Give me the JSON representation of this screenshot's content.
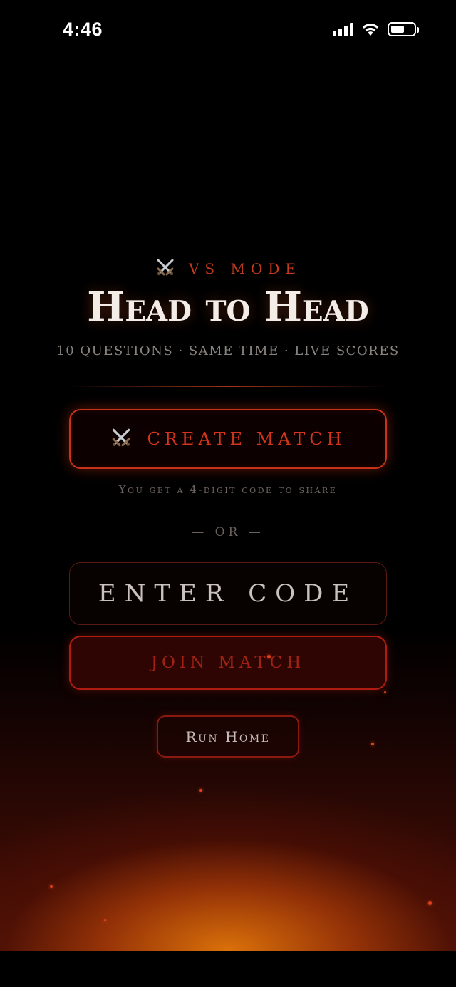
{
  "status_bar": {
    "time": "4:46",
    "signal_icon": "cellular-signal-icon",
    "wifi_icon": "wifi-icon",
    "battery_icon": "battery-icon",
    "battery_level": 0.6
  },
  "header": {
    "kicker_icon": "crossed-swords-icon",
    "kicker": "VS MODE",
    "title": "Head to Head",
    "subtitle": "10 QUESTIONS · SAME TIME · LIVE SCORES"
  },
  "actions": {
    "create_icon": "crossed-swords-icon",
    "create_label": "CREATE MATCH",
    "create_hint": "You get a 4-digit code to share",
    "or_label": "— OR —",
    "code_placeholder": "ENTER CODE",
    "code_value": "",
    "join_label": "JOIN MATCH",
    "home_label": "Run Home"
  },
  "colors": {
    "accent": "#d2341c",
    "title": "#f4ece6",
    "muted": "#8a8480",
    "glow": "#e2760a"
  }
}
